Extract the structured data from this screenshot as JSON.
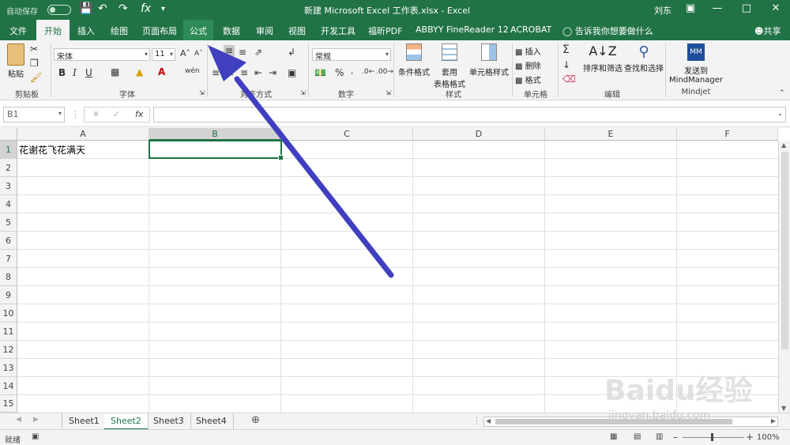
{
  "titlebar": {
    "autosave_label": "自动保存",
    "autosave_state": "关",
    "title": "新建 Microsoft Excel 工作表.xlsx - Excel",
    "user": "刘东",
    "qa_save_icon": "save-icon",
    "qa_undo_icon": "undo-icon",
    "qa_redo_icon": "redo-icon",
    "qa_fx": "fx"
  },
  "tabs": {
    "file": "文件",
    "home": "开始",
    "insert": "插入",
    "draw": "绘图",
    "layout": "页面布局",
    "formulas": "公式",
    "data": "数据",
    "review": "审阅",
    "view": "视图",
    "developer": "开发工具",
    "foxit": "福昕PDF",
    "abbyy": "ABBYY FineReader 12",
    "acrobat": "ACROBAT",
    "tellme": "告诉我你想要做什么",
    "share": "共享"
  },
  "ribbon": {
    "paste": "粘贴",
    "clipboard": "剪贴板",
    "font_name": "宋体",
    "font_size": "11",
    "font_group": "字体",
    "bold": "B",
    "italic": "I",
    "underline": "U",
    "align_group": "对齐方式",
    "number_format": "常规",
    "number_group": "数字",
    "percent": "%",
    "cond_format": "条件格式",
    "table_format_1": "套用",
    "table_format_2": "表格格式",
    "cell_style": "单元格样式",
    "styles_group": "样式",
    "insert": "插入",
    "delete": "删除",
    "format": "格式",
    "cells_group": "单元格",
    "sort_filter": "排序和筛选",
    "find_select": "查找和选择",
    "editing_group": "编辑",
    "mindjet_btn_1": "发送到",
    "mindjet_btn_2": "MindManager",
    "mindjet_group": "Mindjet"
  },
  "formula_bar": {
    "name_box": "B1",
    "fx": "fx",
    "formula": ""
  },
  "grid": {
    "columns": [
      "A",
      "B",
      "C",
      "D",
      "E",
      "F"
    ],
    "rows": [
      "1",
      "2",
      "3",
      "4",
      "5",
      "6",
      "7",
      "8",
      "9",
      "10",
      "11",
      "12",
      "13",
      "14",
      "15"
    ],
    "a1_value": "花谢花飞花满天",
    "selected_cell": "B1"
  },
  "sheets": {
    "tabs": [
      "Sheet1",
      "Sheet2",
      "Sheet3",
      "Sheet4"
    ],
    "active": "Sheet2"
  },
  "status": {
    "ready": "就绪",
    "zoom": "100%"
  },
  "watermark": {
    "brand": "Baidu经验",
    "url": "jingyan.baidu.com"
  },
  "colors": {
    "excel_green": "#217346",
    "arrow": "#3f3fbf"
  }
}
